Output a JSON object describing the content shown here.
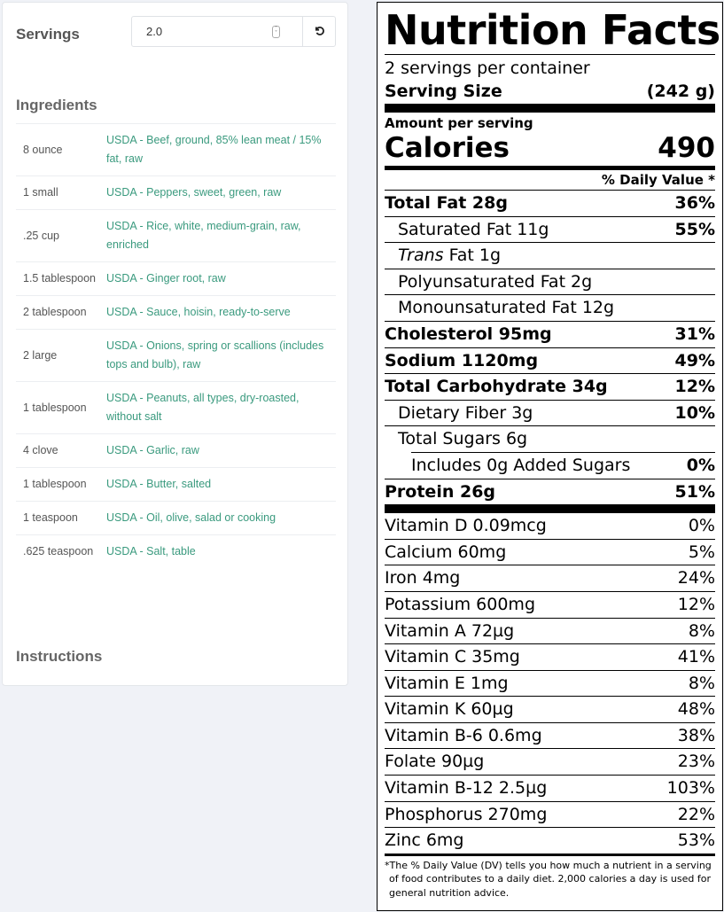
{
  "left_panel": {
    "servings_label": "Servings",
    "servings_value": "2.0",
    "reset_icon": "reset-icon",
    "ingredients_title": "Ingredients",
    "ingredients": [
      {
        "qty": "8 ounce",
        "name": "USDA - Beef, ground, 85% lean meat / 15% fat, raw"
      },
      {
        "qty": "1 small",
        "name": "USDA - Peppers, sweet, green, raw"
      },
      {
        "qty": ".25 cup",
        "name": "USDA - Rice, white, medium-grain, raw, enriched"
      },
      {
        "qty": "1.5 tablespoon",
        "name": "USDA - Ginger root, raw"
      },
      {
        "qty": "2 tablespoon",
        "name": "USDA - Sauce, hoisin, ready-to-serve"
      },
      {
        "qty": "2 large",
        "name": "USDA - Onions, spring or scallions (includes tops and bulb), raw"
      },
      {
        "qty": "1 tablespoon",
        "name": "USDA - Peanuts, all types, dry-roasted, without salt"
      },
      {
        "qty": "4 clove",
        "name": "USDA - Garlic, raw"
      },
      {
        "qty": "1 tablespoon",
        "name": "USDA - Butter, salted"
      },
      {
        "qty": "1 teaspoon",
        "name": "USDA - Oil, olive, salad or cooking"
      },
      {
        "qty": ".625 teaspoon",
        "name": "USDA - Salt, table"
      }
    ],
    "instructions_title": "Instructions"
  },
  "nutrition": {
    "title": "Nutrition Facts",
    "servings_per_container": "2 servings per container",
    "serving_size_label": "Serving Size",
    "serving_size_value": "(242 g)",
    "amount_per_serving": "Amount per serving",
    "calories_label": "Calories",
    "calories_value": "490",
    "daily_value_header": "% Daily Value *",
    "rows": [
      {
        "label": "Total Fat 28g",
        "pct": "36%",
        "style": "bold"
      },
      {
        "label": "Saturated Fat 11g",
        "pct": "55%",
        "style": "indent1",
        "pct_bold": true
      },
      {
        "label_italic": "Trans",
        "label": " Fat 1g",
        "pct": "",
        "style": "indent1"
      },
      {
        "label": "Polyunsaturated Fat 2g",
        "pct": "",
        "style": "indent1"
      },
      {
        "label": "Monounsaturated Fat 12g",
        "pct": "",
        "style": "indent1"
      },
      {
        "label": "Cholesterol 95mg",
        "pct": "31%",
        "style": "bold"
      },
      {
        "label": "Sodium 1120mg",
        "pct": "49%",
        "style": "bold"
      },
      {
        "label": "Total Carbohydrate 34g",
        "pct": "12%",
        "style": "bold"
      },
      {
        "label": "Dietary Fiber 3g",
        "pct": "10%",
        "style": "indent1",
        "pct_bold": true
      },
      {
        "label": "Total Sugars 6g",
        "pct": "",
        "style": "indent1"
      },
      {
        "label": "Includes 0g Added Sugars",
        "pct": "0%",
        "style": "indent2",
        "pct_bold": true
      },
      {
        "label": "Protein 26g",
        "pct": "51%",
        "style": "bold protein"
      },
      {
        "label": "Vitamin D 0.09mcg",
        "pct": "0%"
      },
      {
        "label": "Calcium 60mg",
        "pct": "5%"
      },
      {
        "label": "Iron 4mg",
        "pct": "24%"
      },
      {
        "label": "Potassium 600mg",
        "pct": "12%"
      },
      {
        "label": "Vitamin A 72µg",
        "pct": "8%"
      },
      {
        "label": "Vitamin C 35mg",
        "pct": "41%"
      },
      {
        "label": "Vitamin E 1mg",
        "pct": "8%"
      },
      {
        "label": "Vitamin K 60µg",
        "pct": "48%"
      },
      {
        "label": "Vitamin B-6 0.6mg",
        "pct": "38%"
      },
      {
        "label": "Folate 90µg",
        "pct": "23%"
      },
      {
        "label": "Vitamin B-12 2.5µg",
        "pct": "103%"
      },
      {
        "label": "Phosphorus 270mg",
        "pct": "22%"
      },
      {
        "label": "Zinc 6mg",
        "pct": "53%",
        "style": "last"
      }
    ],
    "footnote": "*The % Daily Value (DV) tells you how much a nutrient in a serving of food contributes to a daily diet. 2,000 calories a day is used for general nutrition advice."
  }
}
